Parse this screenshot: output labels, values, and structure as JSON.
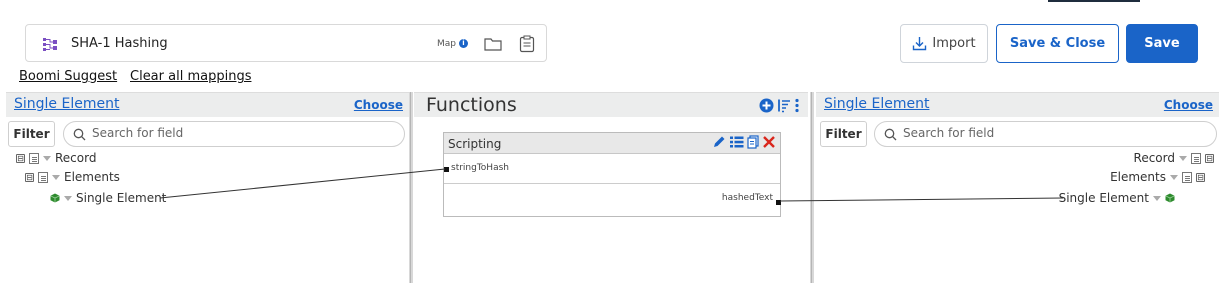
{
  "header": {
    "map_title": "SHA-1 Hashing",
    "map_type": "Map",
    "info_glyph": "i",
    "import_label": "Import",
    "save_close_label": "Save & Close",
    "save_label": "Save"
  },
  "toolbar": {
    "suggest_label": "Boomi Suggest",
    "clear_label": "Clear all mappings"
  },
  "source": {
    "title": "Single Element",
    "choose_label": "Choose",
    "filter_label": "Filter",
    "search_placeholder": "Search for field",
    "tree": [
      {
        "label": "Record",
        "toggle": "⊟"
      },
      {
        "label": "Elements",
        "toggle": "⊟"
      },
      {
        "label": "Single Element"
      }
    ]
  },
  "functions": {
    "title": "Functions",
    "node": {
      "title": "Scripting",
      "input_label": "stringToHash",
      "output_label": "hashedText"
    }
  },
  "destination": {
    "title": "Single Element",
    "choose_label": "Choose",
    "filter_label": "Filter",
    "search_placeholder": "Search for field",
    "tree": [
      {
        "label": "Record",
        "toggle": "⊟"
      },
      {
        "label": "Elements",
        "toggle": "⊟"
      },
      {
        "label": "Single Element"
      }
    ]
  },
  "colors": {
    "accent": "#1a64c8",
    "close_red": "#d9261c",
    "element_green": "#2e8b2e"
  },
  "icons": [
    "process-map-icon",
    "info-icon",
    "folder-icon",
    "clipboard-icon",
    "download-icon",
    "search-icon",
    "add-function-icon",
    "sort-icon",
    "more-vertical-icon",
    "edit-icon",
    "list-icon",
    "copy-icon",
    "close-icon",
    "document-icon",
    "element-cube-icon"
  ]
}
